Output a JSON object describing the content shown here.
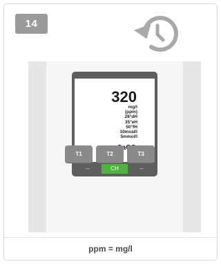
{
  "step": {
    "number": "14"
  },
  "icons": {
    "history": "history-icon"
  },
  "display": {
    "reading": "320",
    "units": [
      "mg/l",
      "(ppm)",
      "28°dH",
      "35°eH",
      "50°fH",
      "10mval/l",
      "5mmol/l"
    ],
    "formula_main": "CaCO",
    "formula_sub": "3"
  },
  "softkeys": {
    "left": "--",
    "middle": "CH",
    "right": "--"
  },
  "softkey_active_color": "#4cb43f",
  "buttons": {
    "t1": "T1",
    "t2": "T2",
    "t3": "T3"
  },
  "caption": "ppm = mg/l"
}
